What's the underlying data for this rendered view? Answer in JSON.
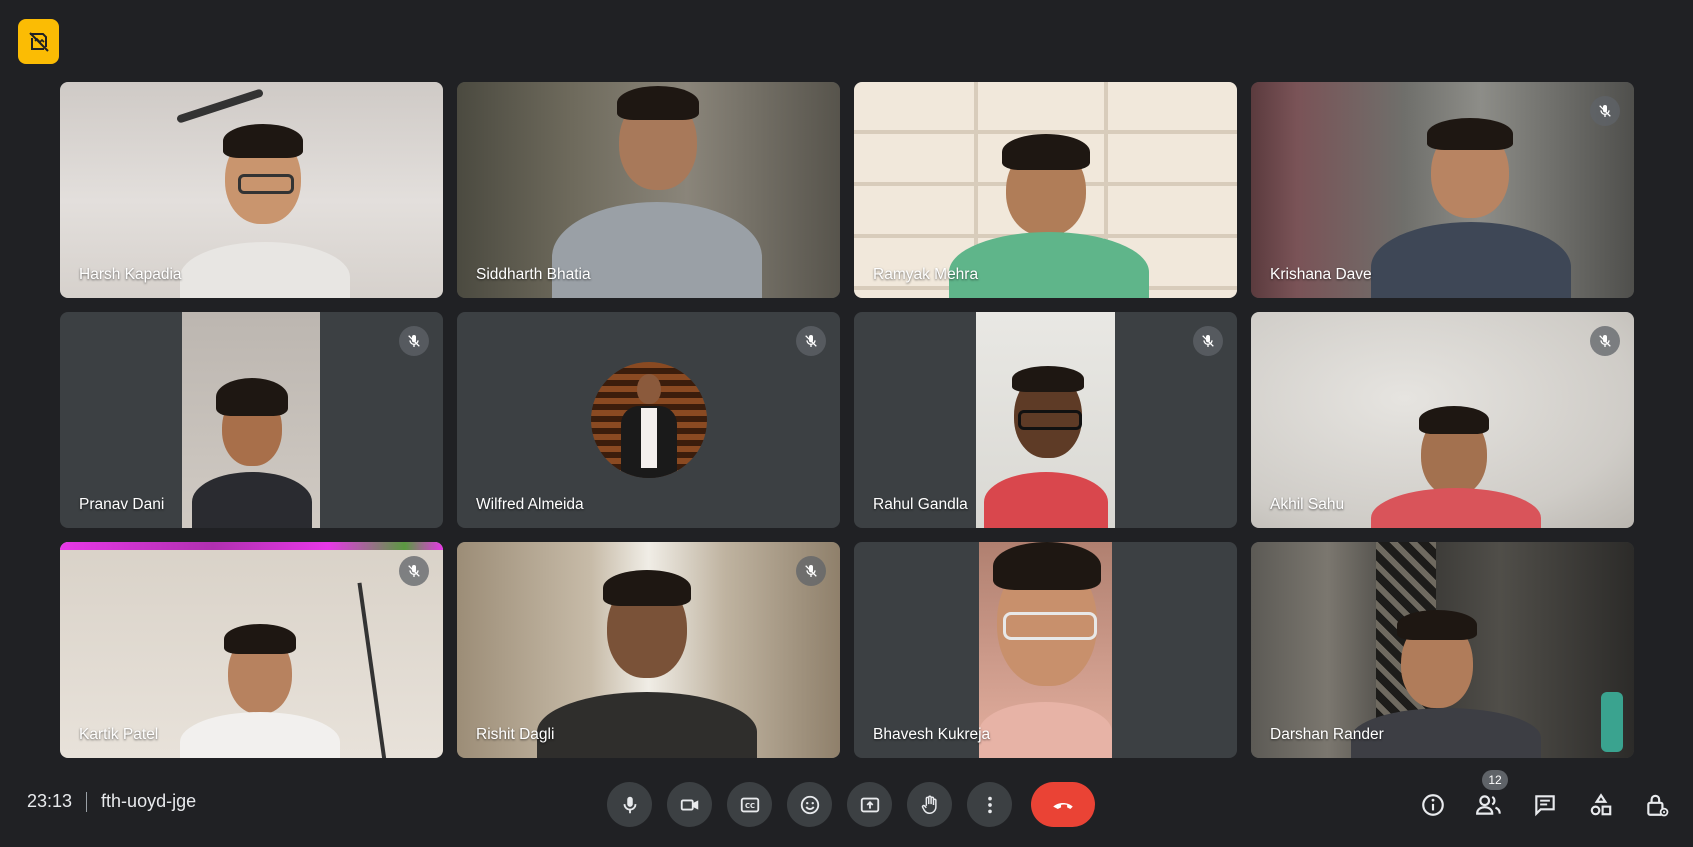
{
  "meeting": {
    "time": "23:13",
    "code": "fth-uoyd-jge",
    "participant_count": "12"
  },
  "participants": [
    {
      "name": "Harsh Kapadia",
      "muted": false
    },
    {
      "name": "Siddharth Bhatia",
      "muted": false
    },
    {
      "name": "Ramyak Mehra",
      "muted": false
    },
    {
      "name": "Krishana Dave",
      "muted": true
    },
    {
      "name": "Pranav Dani",
      "muted": true
    },
    {
      "name": "Wilfred Almeida",
      "muted": true
    },
    {
      "name": "Rahul Gandla",
      "muted": true
    },
    {
      "name": "Akhil Sahu",
      "muted": true
    },
    {
      "name": "Kartik Patel",
      "muted": true
    },
    {
      "name": "Rishit Dagli",
      "muted": true
    },
    {
      "name": "Bhavesh Kukreja",
      "muted": false
    },
    {
      "name": "Darshan Rander",
      "muted": false
    }
  ],
  "controls": [
    {
      "icon": "microphone-icon"
    },
    {
      "icon": "camera-icon"
    },
    {
      "icon": "closed-captions-icon"
    },
    {
      "icon": "emoji-reactions-icon"
    },
    {
      "icon": "present-screen-icon"
    },
    {
      "icon": "raise-hand-icon"
    },
    {
      "icon": "more-options-icon"
    },
    {
      "icon": "end-call-icon"
    }
  ],
  "colors": {
    "background": "#202124",
    "tile": "#3c4043",
    "end_call": "#ea4335",
    "recording_badge": "#fbbc04"
  }
}
